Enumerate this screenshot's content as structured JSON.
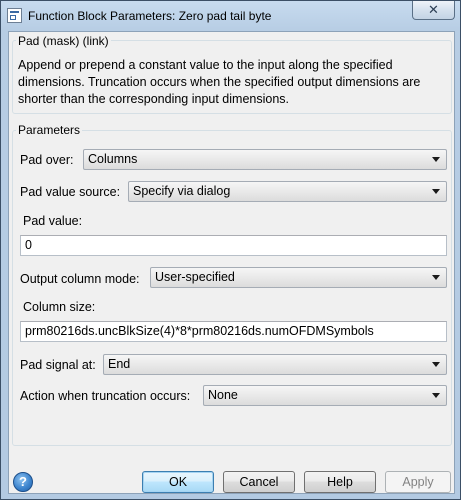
{
  "window": {
    "title": "Function Block Parameters: Zero pad tail byte"
  },
  "mask": {
    "group_title": "Pad (mask) (link)",
    "description": "Append or prepend a constant value to the input along the specified dimensions.  Truncation occurs when the specified output dimensions are shorter than the corresponding input dimensions."
  },
  "parameters": {
    "group_title": "Parameters",
    "pad_over": {
      "label": "Pad over:",
      "value": "Columns"
    },
    "pad_value_source": {
      "label": "Pad value source:",
      "value": "Specify via dialog"
    },
    "pad_value": {
      "label": "Pad value:",
      "value": "0"
    },
    "output_column_mode": {
      "label": "Output column mode:",
      "value": "User-specified"
    },
    "column_size": {
      "label": "Column size:",
      "value": "prm80216ds.uncBlkSize(4)*8*prm80216ds.numOFDMSymbols"
    },
    "pad_signal_at": {
      "label": "Pad signal at:",
      "value": "End"
    },
    "truncation_action": {
      "label": "Action when truncation occurs:",
      "value": "None"
    }
  },
  "buttons": {
    "ok": "OK",
    "cancel": "Cancel",
    "help": "Help",
    "apply": "Apply"
  },
  "icons": {
    "help": "question-icon",
    "close": "close-icon",
    "app": "simulink-block-icon"
  }
}
